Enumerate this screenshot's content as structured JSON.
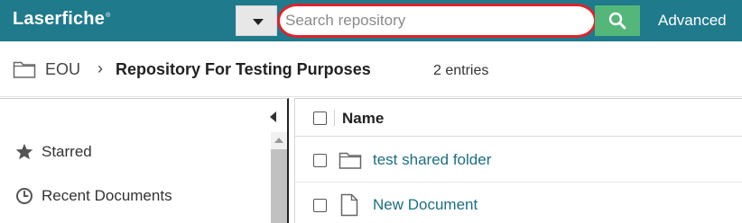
{
  "app": {
    "logo": "Laserfiche",
    "logo_mark": "®"
  },
  "search": {
    "placeholder": "Search repository",
    "value": "",
    "advanced_label": "Advanced"
  },
  "breadcrumb": {
    "root": "EOU",
    "separator": "›",
    "current": "Repository For Testing Purposes",
    "entries": "2 entries"
  },
  "sidebar": {
    "items": [
      {
        "label": "Starred",
        "icon": "star-icon"
      },
      {
        "label": "Recent Documents",
        "icon": "clock-icon"
      }
    ]
  },
  "list": {
    "column_header": "Name",
    "rows": [
      {
        "name": "test shared folder",
        "icon": "folder-icon"
      },
      {
        "name": "New Document",
        "icon": "document-icon"
      }
    ]
  },
  "colors": {
    "topbar": "#1f7a8c",
    "search_button": "#55b67a",
    "highlight": "#e0232b",
    "link": "#1b6e84"
  }
}
